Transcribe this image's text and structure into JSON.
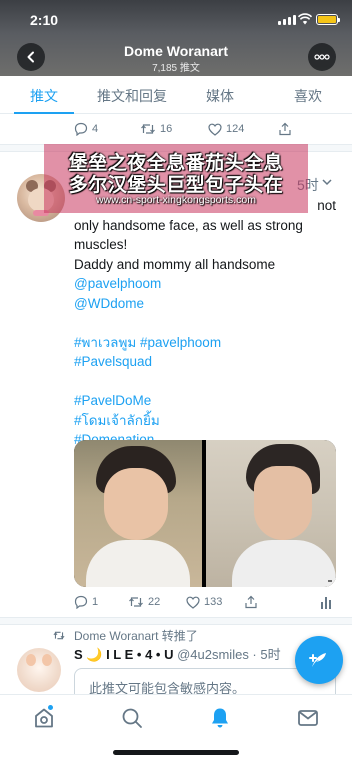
{
  "status_bar": {
    "time": "2:10"
  },
  "header": {
    "title": "Dome Woranart",
    "subtitle": "7,185 推文"
  },
  "tabs": [
    {
      "label": "推文",
      "active": true
    },
    {
      "label": "推文和回复",
      "active": false
    },
    {
      "label": "媒体",
      "active": false
    },
    {
      "label": "喜欢",
      "active": false
    }
  ],
  "prev_tweet_actions": {
    "replies": "4",
    "retweets": "16",
    "likes": "124"
  },
  "overlay": {
    "line1": "堡垒之夜全息番茄头全息",
    "line2": "多尔汉堡头巨型包子头在",
    "url": "www.cn-sport-xingkongsports.com"
  },
  "tweet": {
    "time": "5时",
    "text_lines": [
      {
        "text": "not",
        "kind": "partial"
      },
      {
        "text": "only handsome face, as well as strong",
        "kind": "plain"
      },
      {
        "text": "muscles!",
        "kind": "plain"
      },
      {
        "text": "Daddy and mommy all handsome",
        "kind": "plain"
      },
      {
        "text": "@pavelphoom",
        "kind": "link"
      },
      {
        "text": "@WDdome",
        "kind": "link"
      },
      {
        "text": "",
        "kind": "blank"
      },
      {
        "text": "#พาเวลพูม #pavelphoom",
        "kind": "link"
      },
      {
        "text": "#Pavelsquad",
        "kind": "link"
      },
      {
        "text": "",
        "kind": "blank"
      },
      {
        "text": "#PavelDoMe",
        "kind": "link"
      },
      {
        "text": "#โดมเจ้าลักยิ้ม",
        "kind": "link"
      },
      {
        "text": "#Domenation",
        "kind": "link"
      }
    ],
    "actions": {
      "replies": "1",
      "retweets": "22",
      "likes": "133"
    }
  },
  "retweet": {
    "label": "Dome Woranart 转推了",
    "author_name": "S 🌙 I L E • 4 • U",
    "author_handle": "@4u2smiles · 5时",
    "sensitive_notice": "此推文可能包含敏感内容。"
  },
  "colors": {
    "accent": "#1da1f2",
    "muted": "#657786",
    "text": "#14171a",
    "overlay": "#c8375f"
  },
  "icons": [
    "back-arrow-icon",
    "more-dots-icon",
    "reply-icon",
    "retweet-icon",
    "like-icon",
    "share-icon",
    "analytics-icon",
    "compose-icon",
    "home-icon",
    "search-icon",
    "notifications-icon",
    "messages-icon"
  ]
}
